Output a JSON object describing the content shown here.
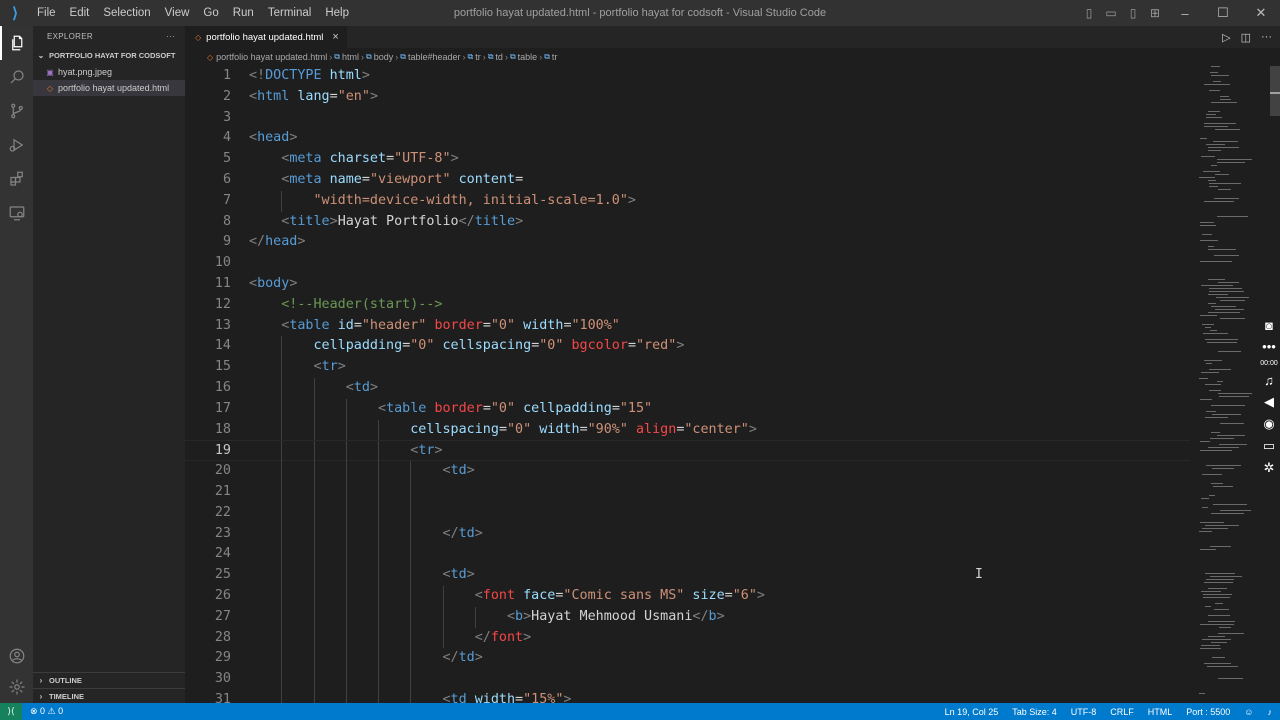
{
  "titlebar": {
    "menu": [
      "File",
      "Edit",
      "Selection",
      "View",
      "Go",
      "Run",
      "Terminal",
      "Help"
    ],
    "title": "portfolio hayat updated.html - portfolio hayat for codsoft - Visual Studio Code"
  },
  "sidebar": {
    "header": "EXPLORER",
    "folder": "PORTFOLIO HAYAT FOR CODSOFT",
    "files": [
      "hyat.png.jpeg",
      "portfolio hayat updated.html"
    ],
    "outline": "OUTLINE",
    "timeline": "TIMELINE"
  },
  "tab": {
    "label": "portfolio hayat updated.html"
  },
  "breadcrumb": [
    "portfolio hayat updated.html",
    "html",
    "body",
    "table#header",
    "tr",
    "td",
    "table",
    "tr"
  ],
  "code": [
    {
      "n": "1",
      "segs": [
        [
          "tb",
          "<!"
        ],
        [
          "tg",
          "DOCTYPE"
        ],
        [
          "tx",
          " "
        ],
        [
          "at",
          "html"
        ],
        [
          "tb",
          ">"
        ]
      ]
    },
    {
      "n": "2",
      "segs": [
        [
          "tb",
          "<"
        ],
        [
          "tg",
          "html"
        ],
        [
          "tx",
          " "
        ],
        [
          "at",
          "lang"
        ],
        [
          "tx",
          "="
        ],
        [
          "sv",
          "\"en\""
        ],
        [
          "tb",
          ">"
        ]
      ]
    },
    {
      "n": "3",
      "segs": []
    },
    {
      "n": "4",
      "segs": [
        [
          "tb",
          "<"
        ],
        [
          "tg",
          "head"
        ],
        [
          "tb",
          ">"
        ]
      ]
    },
    {
      "n": "5",
      "segs": [
        [
          "tx",
          "    "
        ],
        [
          "tb",
          "<"
        ],
        [
          "tg",
          "meta"
        ],
        [
          "tx",
          " "
        ],
        [
          "at",
          "charset"
        ],
        [
          "tx",
          "="
        ],
        [
          "sv",
          "\"UTF-8\""
        ],
        [
          "tb",
          ">"
        ]
      ]
    },
    {
      "n": "6",
      "segs": [
        [
          "tx",
          "    "
        ],
        [
          "tb",
          "<"
        ],
        [
          "tg",
          "meta"
        ],
        [
          "tx",
          " "
        ],
        [
          "at",
          "name"
        ],
        [
          "tx",
          "="
        ],
        [
          "sv",
          "\"viewport\""
        ],
        [
          "tx",
          " "
        ],
        [
          "at",
          "content"
        ],
        [
          "tx",
          "="
        ]
      ]
    },
    {
      "n": "7",
      "segs": [
        [
          "tx",
          "        "
        ],
        [
          "sv",
          "\"width=device-width, initial-scale=1.0\""
        ],
        [
          "tb",
          ">"
        ]
      ]
    },
    {
      "n": "8",
      "segs": [
        [
          "tx",
          "    "
        ],
        [
          "tb",
          "<"
        ],
        [
          "tg",
          "title"
        ],
        [
          "tb",
          ">"
        ],
        [
          "tx",
          "Hayat Portfolio"
        ],
        [
          "tb",
          "</"
        ],
        [
          "tg",
          "title"
        ],
        [
          "tb",
          ">"
        ]
      ]
    },
    {
      "n": "9",
      "segs": [
        [
          "tb",
          "</"
        ],
        [
          "tg",
          "head"
        ],
        [
          "tb",
          ">"
        ]
      ]
    },
    {
      "n": "10",
      "segs": []
    },
    {
      "n": "11",
      "segs": [
        [
          "tb",
          "<"
        ],
        [
          "tg",
          "body"
        ],
        [
          "tb",
          ">"
        ]
      ]
    },
    {
      "n": "12",
      "segs": [
        [
          "tx",
          "    "
        ],
        [
          "cm",
          "<!--Header(start)-->"
        ]
      ]
    },
    {
      "n": "13",
      "segs": [
        [
          "tx",
          "    "
        ],
        [
          "tb",
          "<"
        ],
        [
          "tg",
          "table"
        ],
        [
          "tx",
          " "
        ],
        [
          "at",
          "id"
        ],
        [
          "tx",
          "="
        ],
        [
          "sv",
          "\"header\""
        ],
        [
          "tx",
          " "
        ],
        [
          "dp",
          "border"
        ],
        [
          "tx",
          "="
        ],
        [
          "sv",
          "\"0\""
        ],
        [
          "tx",
          " "
        ],
        [
          "at",
          "width"
        ],
        [
          "tx",
          "="
        ],
        [
          "sv",
          "\"100%\""
        ]
      ]
    },
    {
      "n": "14",
      "segs": [
        [
          "tx",
          "        "
        ],
        [
          "at",
          "cellpadding"
        ],
        [
          "tx",
          "="
        ],
        [
          "sv",
          "\"0\""
        ],
        [
          "tx",
          " "
        ],
        [
          "at",
          "cellspacing"
        ],
        [
          "tx",
          "="
        ],
        [
          "sv",
          "\"0\""
        ],
        [
          "tx",
          " "
        ],
        [
          "dp",
          "bgcolor"
        ],
        [
          "tx",
          "="
        ],
        [
          "sv",
          "\"red\""
        ],
        [
          "tb",
          ">"
        ]
      ]
    },
    {
      "n": "15",
      "segs": [
        [
          "tx",
          "        "
        ],
        [
          "tb",
          "<"
        ],
        [
          "tg",
          "tr"
        ],
        [
          "tb",
          ">"
        ]
      ]
    },
    {
      "n": "16",
      "segs": [
        [
          "tx",
          "            "
        ],
        [
          "tb",
          "<"
        ],
        [
          "tg",
          "td"
        ],
        [
          "tb",
          ">"
        ]
      ]
    },
    {
      "n": "17",
      "segs": [
        [
          "tx",
          "                "
        ],
        [
          "tb",
          "<"
        ],
        [
          "tg",
          "table"
        ],
        [
          "tx",
          " "
        ],
        [
          "dp",
          "border"
        ],
        [
          "tx",
          "="
        ],
        [
          "sv",
          "\"0\""
        ],
        [
          "tx",
          " "
        ],
        [
          "at",
          "cellpadding"
        ],
        [
          "tx",
          "="
        ],
        [
          "sv",
          "\"15\""
        ]
      ]
    },
    {
      "n": "18",
      "segs": [
        [
          "tx",
          "                    "
        ],
        [
          "at",
          "cellspacing"
        ],
        [
          "tx",
          "="
        ],
        [
          "sv",
          "\"0\""
        ],
        [
          "tx",
          " "
        ],
        [
          "at",
          "width"
        ],
        [
          "tx",
          "="
        ],
        [
          "sv",
          "\"90%\""
        ],
        [
          "tx",
          " "
        ],
        [
          "dp",
          "align"
        ],
        [
          "tx",
          "="
        ],
        [
          "sv",
          "\"center\""
        ],
        [
          "tb",
          ">"
        ]
      ]
    },
    {
      "n": "19",
      "segs": [
        [
          "tx",
          "                    "
        ],
        [
          "tb",
          "<"
        ],
        [
          "tg",
          "tr"
        ],
        [
          "tb",
          ">"
        ]
      ]
    },
    {
      "n": "20",
      "segs": [
        [
          "tx",
          "                        "
        ],
        [
          "tb",
          "<"
        ],
        [
          "tg",
          "td"
        ],
        [
          "tb",
          ">"
        ]
      ]
    },
    {
      "n": "21",
      "segs": []
    },
    {
      "n": "22",
      "segs": []
    },
    {
      "n": "23",
      "segs": [
        [
          "tx",
          "                        "
        ],
        [
          "tb",
          "</"
        ],
        [
          "tg",
          "td"
        ],
        [
          "tb",
          ">"
        ]
      ]
    },
    {
      "n": "24",
      "segs": []
    },
    {
      "n": "25",
      "segs": [
        [
          "tx",
          "                        "
        ],
        [
          "tb",
          "<"
        ],
        [
          "tg",
          "td"
        ],
        [
          "tb",
          ">"
        ]
      ]
    },
    {
      "n": "26",
      "segs": [
        [
          "tx",
          "                            "
        ],
        [
          "tb",
          "<"
        ],
        [
          "dp",
          "font"
        ],
        [
          "tx",
          " "
        ],
        [
          "at",
          "face"
        ],
        [
          "tx",
          "="
        ],
        [
          "sv",
          "\"Comic sans MS\""
        ],
        [
          "tx",
          " "
        ],
        [
          "at",
          "size"
        ],
        [
          "tx",
          "="
        ],
        [
          "sv",
          "\"6\""
        ],
        [
          "tb",
          ">"
        ]
      ]
    },
    {
      "n": "27",
      "segs": [
        [
          "tx",
          "                                "
        ],
        [
          "tb",
          "<"
        ],
        [
          "tg",
          "b"
        ],
        [
          "tb",
          ">"
        ],
        [
          "tx",
          "Hayat Mehmood Usmani"
        ],
        [
          "tb",
          "</"
        ],
        [
          "tg",
          "b"
        ],
        [
          "tb",
          ">"
        ]
      ]
    },
    {
      "n": "28",
      "segs": [
        [
          "tx",
          "                            "
        ],
        [
          "tb",
          "</"
        ],
        [
          "dp",
          "font"
        ],
        [
          "tb",
          ">"
        ]
      ]
    },
    {
      "n": "29",
      "segs": [
        [
          "tx",
          "                        "
        ],
        [
          "tb",
          "</"
        ],
        [
          "tg",
          "td"
        ],
        [
          "tb",
          ">"
        ]
      ]
    },
    {
      "n": "30",
      "segs": []
    },
    {
      "n": "31",
      "segs": [
        [
          "tx",
          "                        "
        ],
        [
          "tb",
          "<"
        ],
        [
          "tg",
          "td"
        ],
        [
          "tx",
          " "
        ],
        [
          "at",
          "width"
        ],
        [
          "tx",
          "="
        ],
        [
          "sv",
          "\"15%\""
        ],
        [
          "tb",
          ">"
        ]
      ]
    }
  ],
  "current_line": "19",
  "float_toolbar": {
    "time": "00:00"
  },
  "status": {
    "problems": "⊗ 0 ⚠ 0",
    "position": "Ln 19, Col 25",
    "tabsize": "Tab Size: 4",
    "encoding": "UTF-8",
    "eol": "CRLF",
    "language": "HTML",
    "port": "Port : 5500"
  }
}
